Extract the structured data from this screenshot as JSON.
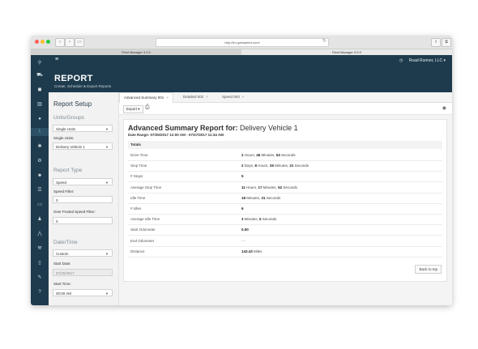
{
  "browser": {
    "url": "http://fm-getstarted.com/",
    "tabs": [
      "Fleet Manager 3.5.0",
      "Fleet Manager 3.5.0"
    ]
  },
  "app": {
    "account": "Road Runner, LLC",
    "account_caret": "▾"
  },
  "sidebar": {
    "items": [
      {
        "icon": "map-pin-icon"
      },
      {
        "icon": "car-icon"
      },
      {
        "icon": "truck-icon"
      },
      {
        "icon": "map-icon"
      },
      {
        "icon": "location-icon"
      },
      {
        "icon": "chart-icon",
        "active": true
      },
      {
        "icon": "settings-icon"
      },
      {
        "icon": "gear-icon"
      },
      {
        "icon": "users-icon"
      },
      {
        "icon": "list-icon"
      },
      {
        "icon": "monitor-icon"
      },
      {
        "icon": "user-icon"
      },
      {
        "icon": "road-icon"
      },
      {
        "icon": "wrench-icon"
      },
      {
        "icon": "document-icon"
      },
      {
        "icon": "tools-icon"
      },
      {
        "icon": "help-icon"
      }
    ]
  },
  "page": {
    "title": "REPORT",
    "subtitle": "Create, Schedule & Export Reports"
  },
  "setup": {
    "heading": "Report Setup",
    "units_section": "Units/Groups",
    "units_select": "Single Units",
    "single_units_label": "Single Units:",
    "single_units_value": "Delivery Vehicle 1",
    "report_type_section": "Report Type",
    "report_type_value": "Speed",
    "speed_filter_label": "Speed Filter:",
    "speed_filter_value": "0",
    "over_posted_label": "Over Posted Speed Filter:",
    "over_posted_value": "0",
    "datetime_section": "Date/Time",
    "datetime_value": "Custom",
    "start_date_label": "Start Date:",
    "start_date_value": "07/25/2017",
    "start_time_label": "Start Time:",
    "start_time_value": "00:00 AM"
  },
  "report_tabs": [
    {
      "label": "Advanced Summary 001",
      "close": "×",
      "active": true
    },
    {
      "label": "Detailed 002",
      "close": "×"
    },
    {
      "label": "Speed 003",
      "close": "×"
    }
  ],
  "toolbar": {
    "export_label": "Export ▾"
  },
  "report": {
    "title_prefix": "Advanced Summary Report for:",
    "title_vehicle": "Delivery Vehicle 1",
    "date_range_label": "Date Range:",
    "date_range_value": "07/25/2017 12:00 AM - 07/27/2017 11:34 AM",
    "totals_label": "Totals",
    "rows": [
      {
        "key": "Drive Time",
        "value": "2 Hours, 46 Minutes, 53 Seconds"
      },
      {
        "key": "Stop Time",
        "value": "2 Days, 8 Hours, 29 Minutes, 21 Seconds"
      },
      {
        "key": "# Stops",
        "value": "5"
      },
      {
        "key": "Average Stop Time",
        "value": "11 Hours, 17 Minutes, 52 Seconds"
      },
      {
        "key": "Idle Time",
        "value": "18 Minutes, 31 Seconds"
      },
      {
        "key": "# Idles",
        "value": "6"
      },
      {
        "key": "Average Idle Time",
        "value": "3 Minutes, 5 Seconds"
      },
      {
        "key": "Start Odometer",
        "value": "0.00"
      },
      {
        "key": "End Odometer",
        "value": "- -"
      },
      {
        "key": "Distance",
        "value": "143.43 Miles"
      }
    ],
    "back_to_top": "Back to top"
  }
}
